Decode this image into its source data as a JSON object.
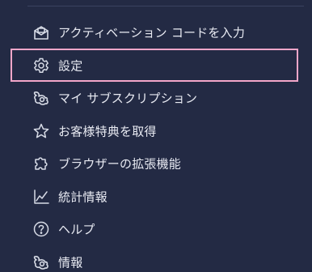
{
  "menu": {
    "items": [
      {
        "label": "アクティベーション コードを入力",
        "icon": "activation-code-icon"
      },
      {
        "label": "設定",
        "icon": "gear-icon",
        "selected": true
      },
      {
        "label": "マイ サブスクリプション",
        "icon": "subscription-icon"
      },
      {
        "label": "お客様特典を取得",
        "icon": "star-icon"
      },
      {
        "label": "ブラウザーの拡張機能",
        "icon": "puzzle-icon"
      },
      {
        "label": "統計情報",
        "icon": "statistics-icon"
      },
      {
        "label": "ヘルプ",
        "icon": "help-icon"
      },
      {
        "label": "情報",
        "icon": "info-logo-icon"
      }
    ]
  },
  "colors": {
    "background": "#232a44",
    "text": "#e8eaf2",
    "icon": "#d7dbe6",
    "selection_border": "#f3a6c9",
    "divider": "#3a4260"
  }
}
